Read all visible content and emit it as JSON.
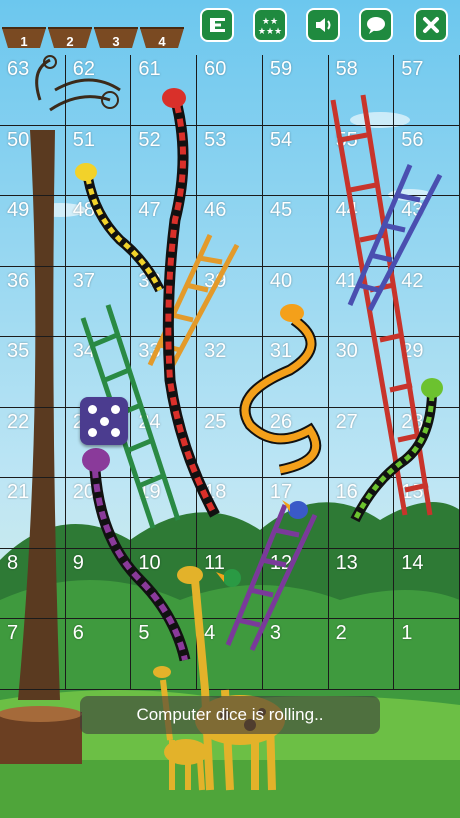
{
  "players": [
    {
      "number": "1"
    },
    {
      "number": "2"
    },
    {
      "number": "3"
    },
    {
      "number": "4"
    }
  ],
  "toolbar": {
    "buttons": [
      {
        "icon": "menu-icon"
      },
      {
        "icon": "stars-rating-icon"
      },
      {
        "icon": "sound-icon"
      },
      {
        "icon": "chat-icon"
      },
      {
        "icon": "close-icon"
      }
    ]
  },
  "board": {
    "rows": [
      [
        "63",
        "62",
        "61",
        "60",
        "59",
        "58",
        "57"
      ],
      [
        "50",
        "51",
        "52",
        "53",
        "54",
        "55",
        "56"
      ],
      [
        "49",
        "48",
        "47",
        "46",
        "45",
        "44",
        "43"
      ],
      [
        "36",
        "37",
        "38",
        "39",
        "40",
        "41",
        "42"
      ],
      [
        "35",
        "34",
        "33",
        "32",
        "31",
        "30",
        "29"
      ],
      [
        "22",
        "23",
        "24",
        "25",
        "26",
        "27",
        "28"
      ],
      [
        "21",
        "20",
        "19",
        "18",
        "17",
        "16",
        "15"
      ],
      [
        "8",
        "9",
        "10",
        "11",
        "12",
        "13",
        "14"
      ],
      [
        "7",
        "6",
        "5",
        "4",
        "3",
        "2",
        "1"
      ]
    ]
  },
  "dice": {
    "face_value": 5
  },
  "status": {
    "message": "Computer dice is rolling.."
  },
  "colors": {
    "button_green": "#1f8a3f",
    "dice_purple": "#4b3c8f",
    "sky": "#7fd0f0",
    "grass": "#3a8f3a"
  }
}
